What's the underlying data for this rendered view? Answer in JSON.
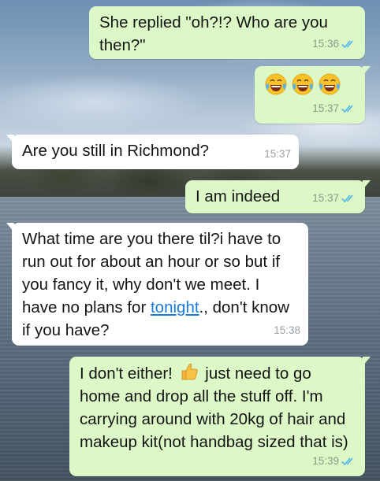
{
  "messages": [
    {
      "id": "m1",
      "dir": "out",
      "text": "She replied \"oh?!? Who are you then?\"",
      "time": "15:36",
      "status": "read"
    },
    {
      "id": "m2",
      "dir": "out",
      "emoji": [
        "face-with-tears-of-joy",
        "face-with-tears-of-joy",
        "face-with-tears-of-joy"
      ],
      "time": "15:37",
      "status": "read"
    },
    {
      "id": "m3",
      "dir": "in",
      "text": "Are you still in Richmond?",
      "time": "15:37"
    },
    {
      "id": "m4",
      "dir": "out",
      "text": "I am indeed",
      "time": "15:37",
      "status": "read"
    },
    {
      "id": "m5",
      "dir": "in",
      "text_before": "What time are you there til?i have to run out for about an hour or so but if you fancy it, why don't we meet. I have no plans for ",
      "link": "tonight",
      "text_after": "., don't know if you have?",
      "time": "15:38"
    },
    {
      "id": "m6",
      "dir": "out",
      "text_before": "I don't either! ",
      "emoji": "thumbs-up",
      "text_after": " just need to go home and drop all the stuff off. I'm carrying around with 20kg of hair and makeup kit(not handbag sized that is)",
      "time": "15:39",
      "status": "read"
    }
  ],
  "colors": {
    "outgoing_bubble": "#dcf8c6",
    "incoming_bubble": "#ffffff",
    "read_ticks": "#4fb6ec",
    "link": "#1a7ad9"
  }
}
